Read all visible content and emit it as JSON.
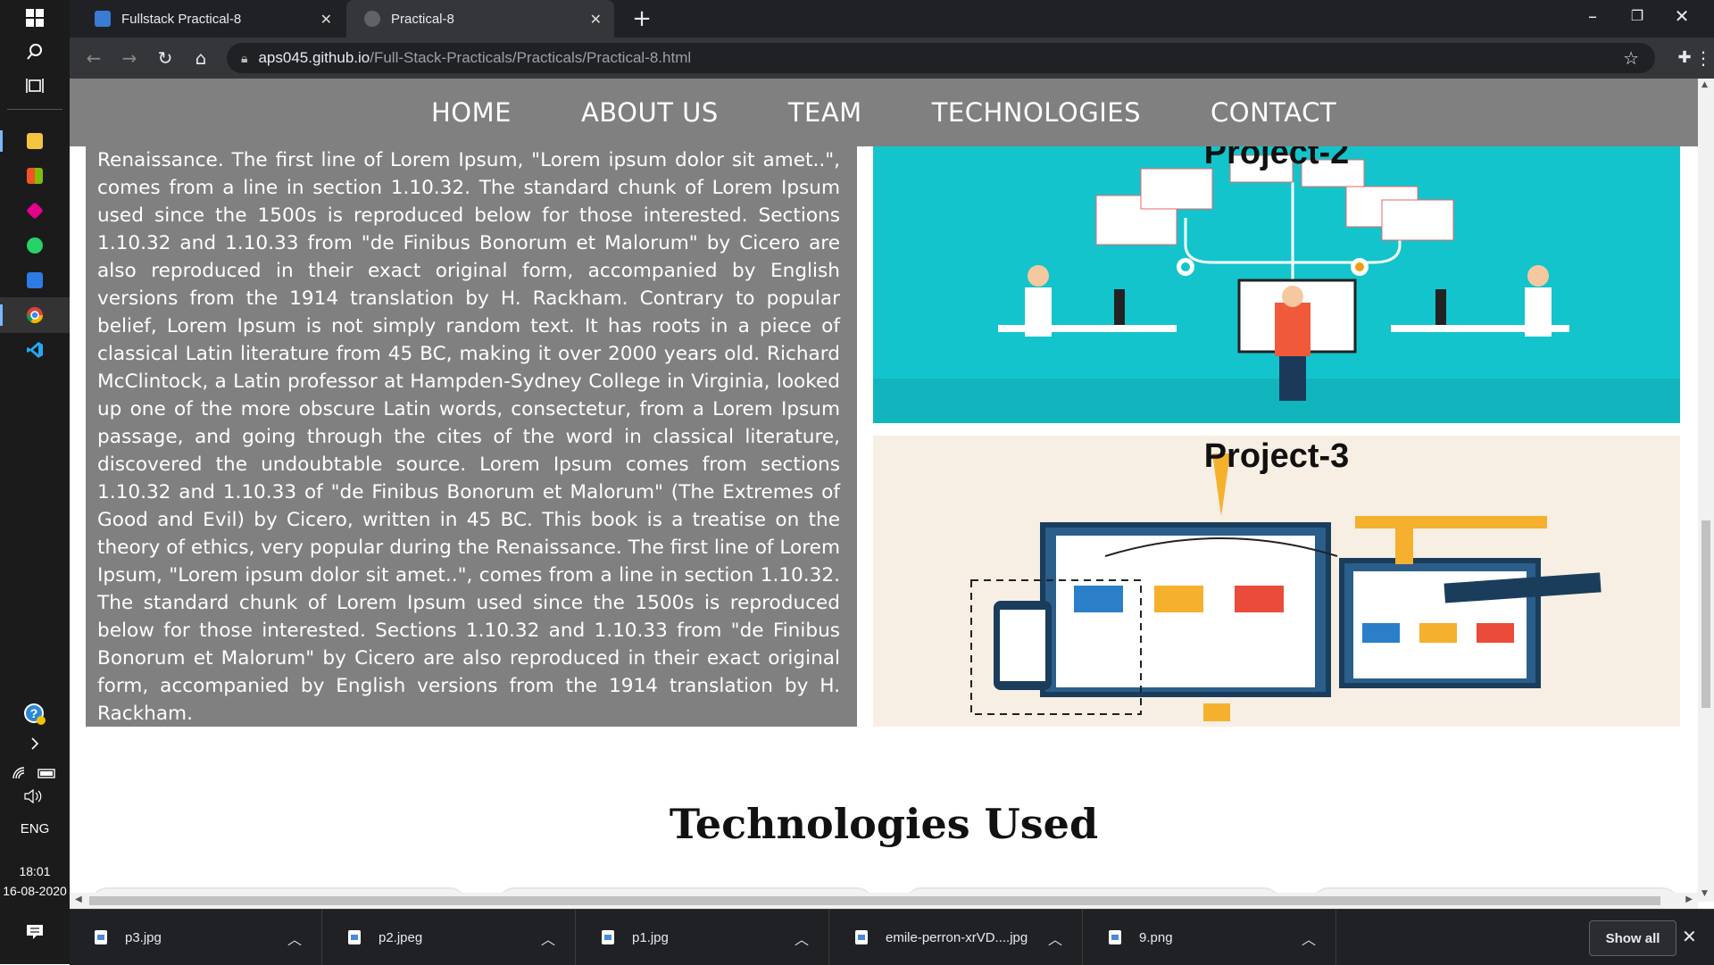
{
  "taskbar": {
    "lang": "ENG",
    "time": "18:01",
    "date": "16-08-2020",
    "apps": [
      "file-explorer-icon",
      "store-icon",
      "office-icon",
      "whatsapp-icon",
      "camera-icon",
      "chrome-icon",
      "vscode-icon"
    ]
  },
  "tabs": [
    {
      "title": "Fullstack Practical-8",
      "active": false
    },
    {
      "title": "Practical-8",
      "active": true
    }
  ],
  "address": {
    "host": "aps045.github.io",
    "path": "/Full-Stack-Practicals/Practicals/Practical-8.html"
  },
  "nav": {
    "items": [
      "HOME",
      "ABOUT US",
      "TEAM",
      "TECHNOLOGIES",
      "CONTACT"
    ]
  },
  "article": {
    "text": "Renaissance. The first line of Lorem Ipsum, \"Lorem ipsum dolor sit amet..\", comes from a line in section 1.10.32. The standard chunk of Lorem Ipsum used since the 1500s is reproduced below for those interested. Sections 1.10.32 and 1.10.33 from \"de Finibus Bonorum et Malorum\" by Cicero are also reproduced in their exact original form, accompanied by English versions from the 1914 translation by H. Rackham. Contrary to popular belief, Lorem Ipsum is not simply random text. It has roots in a piece of classical Latin literature from 45 BC, making it over 2000 years old. Richard McClintock, a Latin professor at Hampden-Sydney College in Virginia, looked up one of the more obscure Latin words, consectetur, from a Lorem Ipsum passage, and going through the cites of the word in classical literature, discovered the undoubtable source. Lorem Ipsum comes from sections 1.10.32 and 1.10.33 of \"de Finibus Bonorum et Malorum\" (The Extremes of Good and Evil) by Cicero, written in 45 BC. This book is a treatise on the theory of ethics, very popular during the Renaissance. The first line of Lorem Ipsum, \"Lorem ipsum dolor sit amet..\", comes from a line in section 1.10.32. The standard chunk of Lorem Ipsum used since the 1500s is reproduced below for those interested. Sections 1.10.32 and 1.10.33 from \"de Finibus Bonorum et Malorum\" by Cicero are also reproduced in their exact original form, accompanied by English versions from the 1914 translation by H. Rackham."
  },
  "projects": [
    {
      "title": "Project-2"
    },
    {
      "title": "Project-3"
    }
  ],
  "technologies": {
    "heading": "Technologies Used"
  },
  "downloads": {
    "items": [
      "p3.jpg",
      "p2.jpeg",
      "p1.jpg",
      "emile-perron-xrVD....jpg",
      "9.png"
    ],
    "show_all": "Show all"
  },
  "colors": {
    "nav_bg": "#808080",
    "project2_bg": "#13c4cc",
    "project3_bg": "#f7efe3"
  }
}
